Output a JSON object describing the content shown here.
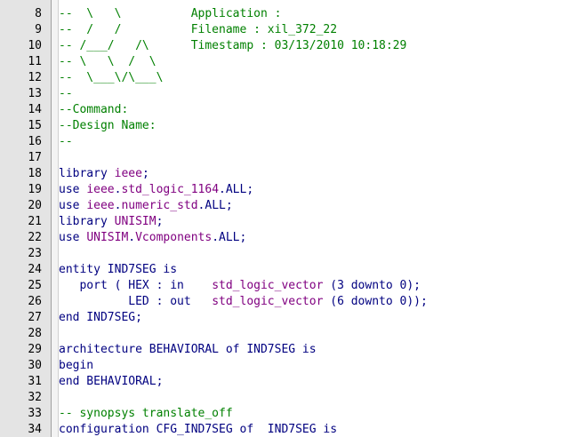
{
  "colors": {
    "comment": "#008000",
    "keyword": "#000080",
    "library": "#800080",
    "type": "#800080",
    "plain": "#000080",
    "gutter_bg": "#e4e4e4",
    "linenumber": "#000000"
  },
  "lines": [
    {
      "n": "8",
      "tokens": [
        {
          "t": "--  \\   \\          Application : ",
          "c": "comment"
        }
      ]
    },
    {
      "n": "9",
      "tokens": [
        {
          "t": "--  /   /          Filename : xil_372_22",
          "c": "comment"
        }
      ]
    },
    {
      "n": "10",
      "tokens": [
        {
          "t": "-- /___/   /\\      Timestamp : 03/13/2010 10:18:29",
          "c": "comment"
        }
      ]
    },
    {
      "n": "11",
      "tokens": [
        {
          "t": "-- \\   \\  /  \\",
          "c": "comment"
        }
      ]
    },
    {
      "n": "12",
      "tokens": [
        {
          "t": "--  \\___\\/\\___\\",
          "c": "comment"
        }
      ]
    },
    {
      "n": "13",
      "tokens": [
        {
          "t": "--",
          "c": "comment"
        }
      ]
    },
    {
      "n": "14",
      "tokens": [
        {
          "t": "--Command:",
          "c": "comment"
        }
      ]
    },
    {
      "n": "15",
      "tokens": [
        {
          "t": "--Design Name:",
          "c": "comment"
        }
      ]
    },
    {
      "n": "16",
      "tokens": [
        {
          "t": "--",
          "c": "comment"
        }
      ]
    },
    {
      "n": "17",
      "tokens": []
    },
    {
      "n": "18",
      "tokens": [
        {
          "t": "library ",
          "c": "keyword"
        },
        {
          "t": "ieee",
          "c": "library"
        },
        {
          "t": ";",
          "c": "plain"
        }
      ]
    },
    {
      "n": "19",
      "tokens": [
        {
          "t": "use ",
          "c": "keyword"
        },
        {
          "t": "ieee",
          "c": "library"
        },
        {
          "t": ".",
          "c": "plain"
        },
        {
          "t": "std_logic_1164",
          "c": "library"
        },
        {
          "t": ".ALL;",
          "c": "plain"
        }
      ]
    },
    {
      "n": "20",
      "tokens": [
        {
          "t": "use ",
          "c": "keyword"
        },
        {
          "t": "ieee",
          "c": "library"
        },
        {
          "t": ".",
          "c": "plain"
        },
        {
          "t": "numeric_std",
          "c": "library"
        },
        {
          "t": ".ALL;",
          "c": "plain"
        }
      ]
    },
    {
      "n": "21",
      "tokens": [
        {
          "t": "library ",
          "c": "keyword"
        },
        {
          "t": "UNISIM",
          "c": "library"
        },
        {
          "t": ";",
          "c": "plain"
        }
      ]
    },
    {
      "n": "22",
      "tokens": [
        {
          "t": "use ",
          "c": "keyword"
        },
        {
          "t": "UNISIM",
          "c": "library"
        },
        {
          "t": ".",
          "c": "plain"
        },
        {
          "t": "Vcomponents",
          "c": "library"
        },
        {
          "t": ".ALL;",
          "c": "plain"
        }
      ]
    },
    {
      "n": "23",
      "tokens": []
    },
    {
      "n": "24",
      "tokens": [
        {
          "t": "entity IND7SEG is",
          "c": "keyword"
        }
      ]
    },
    {
      "n": "25",
      "tokens": [
        {
          "t": "   port ( HEX : in    ",
          "c": "keyword"
        },
        {
          "t": "std_logic_vector",
          "c": "type"
        },
        {
          "t": " (3 downto 0);",
          "c": "keyword"
        }
      ]
    },
    {
      "n": "26",
      "tokens": [
        {
          "t": "          LED : out   ",
          "c": "keyword"
        },
        {
          "t": "std_logic_vector",
          "c": "type"
        },
        {
          "t": " (6 downto 0));",
          "c": "keyword"
        }
      ]
    },
    {
      "n": "27",
      "tokens": [
        {
          "t": "end IND7SEG;",
          "c": "keyword"
        }
      ]
    },
    {
      "n": "28",
      "tokens": []
    },
    {
      "n": "29",
      "tokens": [
        {
          "t": "architecture BEHAVIORAL of IND7SEG is",
          "c": "keyword"
        }
      ]
    },
    {
      "n": "30",
      "tokens": [
        {
          "t": "begin",
          "c": "keyword"
        }
      ]
    },
    {
      "n": "31",
      "tokens": [
        {
          "t": "end BEHAVIORAL;",
          "c": "keyword"
        }
      ]
    },
    {
      "n": "32",
      "tokens": []
    },
    {
      "n": "33",
      "tokens": [
        {
          "t": "-- synopsys translate_off",
          "c": "comment"
        }
      ]
    },
    {
      "n": "34",
      "tokens": [
        {
          "t": "configuration CFG_IND7SEG of  IND7SEG is",
          "c": "keyword"
        }
      ]
    }
  ]
}
